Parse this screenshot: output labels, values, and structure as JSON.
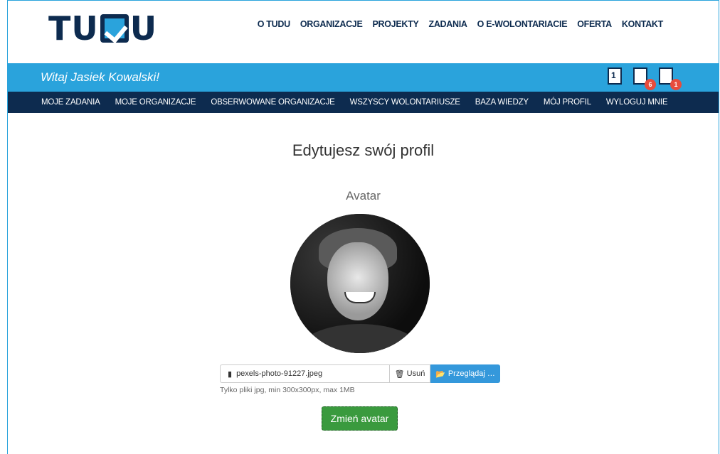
{
  "logo": {
    "left": "TU",
    "right": "U"
  },
  "main_nav": [
    "O TUDU",
    "ORGANIZACJE",
    "PROJEKTY",
    "ZADANIA",
    "O E-WOLONTARIACIE",
    "OFERTA",
    "KONTAKT"
  ],
  "welcome": "Witaj Jasiek Kowalski!",
  "header_icons": [
    {
      "icon": "calendar-icon",
      "label": "1",
      "badge": ""
    },
    {
      "icon": "clipboard-icon",
      "label": "",
      "badge": "6"
    },
    {
      "icon": "message-icon",
      "label": "",
      "badge": "1"
    }
  ],
  "user_nav": [
    "MOJE ZADANIA",
    "MOJE ORGANIZACJE",
    "OBSERWOWANE ORGANIZACJE",
    "WSZYSCY WOLONTARIUSZE",
    "BAZA WIEDZY",
    "MÓJ PROFIL",
    "WYLOGUJ MNIE"
  ],
  "page_title": "Edytujesz swój profil",
  "avatar": {
    "label": "Avatar",
    "file_name": "pexels-photo-91227.jpeg",
    "remove_label": "Usuń",
    "browse_label": "Przeglądaj …",
    "hint": "Tylko pliki jpg, min 300x300px, max 1MB",
    "submit_label": "Zmień avatar"
  },
  "colors": {
    "navy": "#0d2b4f",
    "blue": "#2aa3dc",
    "green": "#3a9a3e",
    "badge": "#e74c3c"
  }
}
